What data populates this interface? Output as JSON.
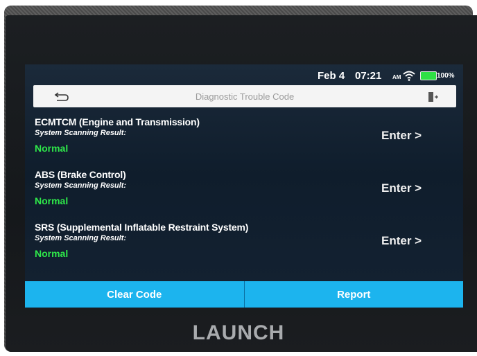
{
  "status_bar": {
    "date": "Feb 4",
    "time": "07:21",
    "am_pm": "AM",
    "battery": "100%"
  },
  "header": {
    "title": "Diagnostic Trouble Code",
    "back_icon": "back-arrow-icon",
    "exit_icon": "exit-icon"
  },
  "systems": [
    {
      "name": "ECMTCM (Engine and Transmission)",
      "result_label": "System Scanning Result:",
      "status": "Normal",
      "action": "Enter >"
    },
    {
      "name": "ABS (Brake Control)",
      "result_label": "System Scanning Result:",
      "status": "Normal",
      "action": "Enter >"
    },
    {
      "name": "SRS (Supplemental Inflatable Restraint System)",
      "result_label": "System Scanning Result:",
      "status": "Normal",
      "action": "Enter >"
    }
  ],
  "footer": {
    "clear_code": "Clear Code",
    "report": "Report"
  },
  "device": {
    "brand": "LAUNCH"
  },
  "colors": {
    "accent": "#1cb4ee",
    "status_normal": "#2ee84a",
    "battery": "#2fe045"
  }
}
